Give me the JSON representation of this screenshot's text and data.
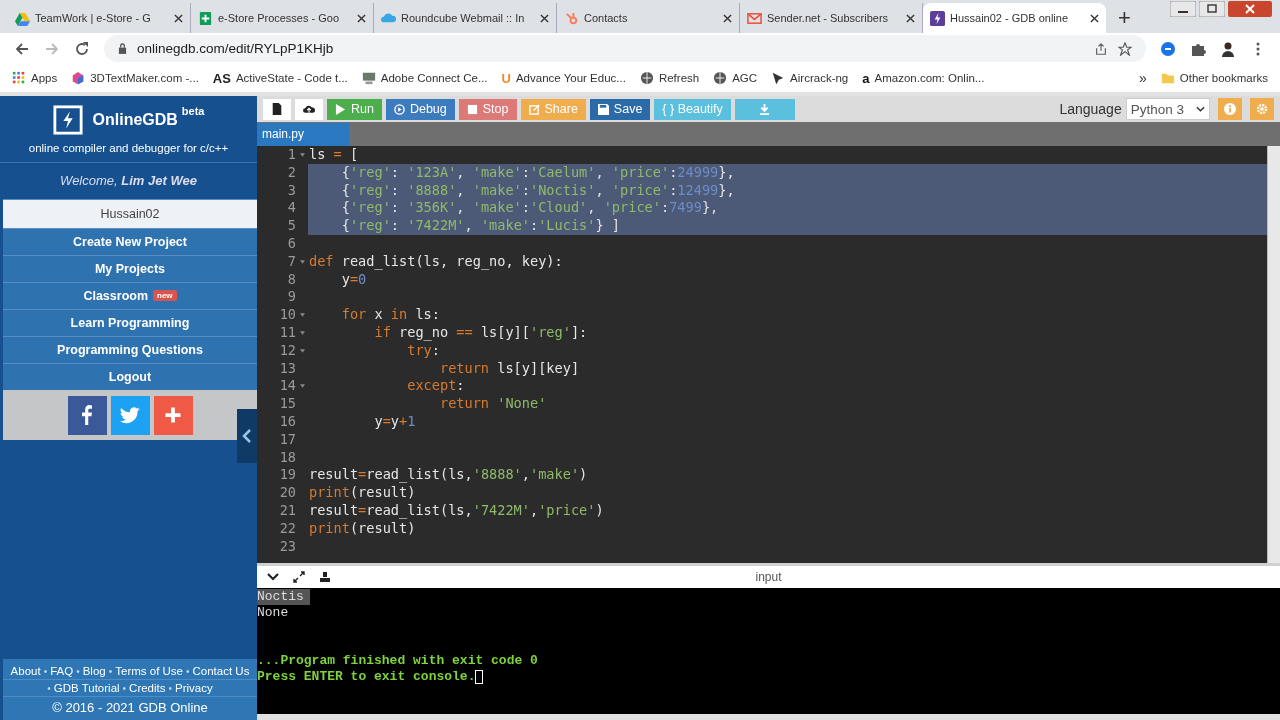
{
  "browser": {
    "tabs": [
      {
        "title": "TeamWork | e-Store - G",
        "selected": false
      },
      {
        "title": "e-Store Processes - Goo",
        "selected": false
      },
      {
        "title": "Roundcube Webmail :: In",
        "selected": false
      },
      {
        "title": "Contacts",
        "selected": false
      },
      {
        "title": "Sender.net - Subscribers",
        "selected": false
      },
      {
        "title": "Hussain02 - GDB online",
        "selected": true
      }
    ],
    "new_tab": "+",
    "url": "onlinegdb.com/edit/RYLpP1KHjb",
    "bookmarks": [
      {
        "label": "Apps"
      },
      {
        "label": "3DTextMaker.com -..."
      },
      {
        "label": "ActiveState - Code t...",
        "logo": "AS"
      },
      {
        "label": "Adobe Connect Ce..."
      },
      {
        "label": "Advance Your Educ...",
        "logo": "U"
      },
      {
        "label": "Refresh"
      },
      {
        "label": "AGC"
      },
      {
        "label": "Aircrack-ng"
      },
      {
        "label": "Amazon.com: Onlin...",
        "logo": "a"
      }
    ],
    "more": "»",
    "other_bookmarks": "Other bookmarks"
  },
  "sidebar": {
    "brand": "OnlineGDB",
    "brand_sup": "beta",
    "tagline": "online compiler and debugger for c/c++",
    "welcome": "Welcome, ",
    "user": "Lim Jet Wee",
    "items": [
      {
        "label": "Hussain02",
        "selected": true
      },
      {
        "label": "Create New Project",
        "selected": false
      },
      {
        "label": "My Projects",
        "selected": false
      },
      {
        "label": "Classroom",
        "selected": false,
        "badge": "new"
      },
      {
        "label": "Learn Programming",
        "selected": false
      },
      {
        "label": "Programming Questions",
        "selected": false
      },
      {
        "label": "Logout",
        "selected": false
      }
    ],
    "footer": [
      [
        {
          "kind": "link",
          "text": "About"
        },
        {
          "kind": "sep",
          "text": "•"
        },
        {
          "kind": "link",
          "text": "FAQ"
        },
        {
          "kind": "sep",
          "text": "•"
        },
        {
          "kind": "link",
          "text": "Blog"
        },
        {
          "kind": "sep",
          "text": "•"
        },
        {
          "kind": "link",
          "text": "Terms of Use"
        },
        {
          "kind": "sep",
          "text": "•"
        },
        {
          "kind": "link",
          "text": "Contact Us"
        }
      ],
      [
        {
          "kind": "sep",
          "text": "•"
        },
        {
          "kind": "link",
          "text": "GDB Tutorial"
        },
        {
          "kind": "sep",
          "text": "•"
        },
        {
          "kind": "link",
          "text": "Credits"
        },
        {
          "kind": "sep",
          "text": "•"
        },
        {
          "kind": "link",
          "text": "Privacy"
        }
      ]
    ],
    "copyright": "© 2016 - 2021 GDB Online"
  },
  "toolbar": {
    "buttons": [
      {
        "kind": "new"
      },
      {
        "kind": "upload"
      },
      {
        "kind": "run",
        "label": "Run"
      },
      {
        "kind": "debug",
        "label": "Debug"
      },
      {
        "kind": "stop",
        "label": "Stop"
      },
      {
        "kind": "share",
        "label": "Share"
      },
      {
        "kind": "save",
        "label": "Save"
      },
      {
        "kind": "beautify",
        "label": "{ } Beautify"
      },
      {
        "kind": "download"
      }
    ],
    "language_label": "Language",
    "language": "Python 3"
  },
  "file_tabs": [
    {
      "label": "main.py",
      "selected": true
    }
  ],
  "editor": {
    "lines": [
      {
        "n": "1",
        "fold": true,
        "selected": false,
        "tokens": [
          {
            "kind": "text",
            "text": "ls "
          },
          {
            "kind": "op",
            "text": "="
          },
          {
            "kind": "text",
            "text": " ["
          }
        ]
      },
      {
        "n": "2",
        "fold": false,
        "selected": true,
        "tokens": [
          {
            "kind": "text",
            "text": "    {"
          },
          {
            "kind": "str",
            "text": "'reg'"
          },
          {
            "kind": "text",
            "text": ": "
          },
          {
            "kind": "str",
            "text": "'123A'"
          },
          {
            "kind": "text",
            "text": ", "
          },
          {
            "kind": "str",
            "text": "'make'"
          },
          {
            "kind": "text",
            "text": ":"
          },
          {
            "kind": "str",
            "text": "'Caelum'"
          },
          {
            "kind": "text",
            "text": ", "
          },
          {
            "kind": "str",
            "text": "'price'"
          },
          {
            "kind": "text",
            "text": ":"
          },
          {
            "kind": "num",
            "text": "24999"
          },
          {
            "kind": "text",
            "text": "},"
          }
        ]
      },
      {
        "n": "3",
        "fold": false,
        "selected": true,
        "tokens": [
          {
            "kind": "text",
            "text": "    {"
          },
          {
            "kind": "str",
            "text": "'reg'"
          },
          {
            "kind": "text",
            "text": ": "
          },
          {
            "kind": "str",
            "text": "'8888'"
          },
          {
            "kind": "text",
            "text": ", "
          },
          {
            "kind": "str",
            "text": "'make'"
          },
          {
            "kind": "text",
            "text": ":"
          },
          {
            "kind": "str",
            "text": "'Noctis'"
          },
          {
            "kind": "text",
            "text": ", "
          },
          {
            "kind": "str",
            "text": "'price'"
          },
          {
            "kind": "text",
            "text": ":"
          },
          {
            "kind": "num",
            "text": "12499"
          },
          {
            "kind": "text",
            "text": "},"
          }
        ]
      },
      {
        "n": "4",
        "fold": false,
        "selected": true,
        "tokens": [
          {
            "kind": "text",
            "text": "    {"
          },
          {
            "kind": "str",
            "text": "'reg'"
          },
          {
            "kind": "text",
            "text": ": "
          },
          {
            "kind": "str",
            "text": "'356K'"
          },
          {
            "kind": "text",
            "text": ", "
          },
          {
            "kind": "str",
            "text": "'make'"
          },
          {
            "kind": "text",
            "text": ":"
          },
          {
            "kind": "str",
            "text": "'Cloud'"
          },
          {
            "kind": "text",
            "text": ", "
          },
          {
            "kind": "str",
            "text": "'price'"
          },
          {
            "kind": "text",
            "text": ":"
          },
          {
            "kind": "num",
            "text": "7499"
          },
          {
            "kind": "text",
            "text": "},"
          }
        ]
      },
      {
        "n": "5",
        "fold": false,
        "selected": true,
        "tokens": [
          {
            "kind": "text",
            "text": "    {"
          },
          {
            "kind": "str",
            "text": "'reg'"
          },
          {
            "kind": "text",
            "text": ": "
          },
          {
            "kind": "str",
            "text": "'7422M'"
          },
          {
            "kind": "text",
            "text": ", "
          },
          {
            "kind": "str",
            "text": "'make'"
          },
          {
            "kind": "text",
            "text": ":"
          },
          {
            "kind": "str",
            "text": "'Lucis'"
          },
          {
            "kind": "text",
            "text": "} ]"
          }
        ]
      },
      {
        "n": "6",
        "fold": false,
        "selected": false
      },
      {
        "n": "7",
        "fold": true,
        "selected": false,
        "tokens": [
          {
            "kind": "kw",
            "text": "def"
          },
          {
            "kind": "text",
            "text": " read_list(ls, reg_no, key):"
          }
        ]
      },
      {
        "n": "8",
        "fold": false,
        "selected": false,
        "tokens": [
          {
            "kind": "text",
            "text": "    y"
          },
          {
            "kind": "op",
            "text": "="
          },
          {
            "kind": "num",
            "text": "0"
          }
        ]
      },
      {
        "n": "9",
        "fold": false,
        "selected": false
      },
      {
        "n": "10",
        "fold": true,
        "selected": false,
        "tokens": [
          {
            "kind": "kw",
            "text": "    for"
          },
          {
            "kind": "text",
            "text": " x "
          },
          {
            "kind": "kw",
            "text": "in"
          },
          {
            "kind": "text",
            "text": " ls:"
          }
        ]
      },
      {
        "n": "11",
        "fold": true,
        "selected": false,
        "tokens": [
          {
            "kind": "kw",
            "text": "        if"
          },
          {
            "kind": "text",
            "text": " reg_no "
          },
          {
            "kind": "op",
            "text": "=="
          },
          {
            "kind": "text",
            "text": " ls[y]["
          },
          {
            "kind": "str",
            "text": "'reg'"
          },
          {
            "kind": "text",
            "text": "]:"
          }
        ]
      },
      {
        "n": "12",
        "fold": true,
        "selected": false,
        "tokens": [
          {
            "kind": "kw",
            "text": "            try"
          },
          {
            "kind": "text",
            "text": ":"
          }
        ]
      },
      {
        "n": "13",
        "fold": false,
        "selected": false,
        "tokens": [
          {
            "kind": "kw",
            "text": "                return"
          },
          {
            "kind": "text",
            "text": " ls[y][key]"
          }
        ]
      },
      {
        "n": "14",
        "fold": true,
        "selected": false,
        "tokens": [
          {
            "kind": "kw",
            "text": "            except"
          },
          {
            "kind": "text",
            "text": ":"
          }
        ]
      },
      {
        "n": "15",
        "fold": false,
        "selected": false,
        "tokens": [
          {
            "kind": "kw",
            "text": "                return"
          },
          {
            "kind": "str",
            "text": " 'None'"
          }
        ]
      },
      {
        "n": "16",
        "fold": false,
        "selected": false,
        "tokens": [
          {
            "kind": "text",
            "text": "        y"
          },
          {
            "kind": "op",
            "text": "="
          },
          {
            "kind": "text",
            "text": "y"
          },
          {
            "kind": "op",
            "text": "+"
          },
          {
            "kind": "num",
            "text": "1"
          }
        ]
      },
      {
        "n": "17",
        "fold": false,
        "selected": false
      },
      {
        "n": "18",
        "fold": false,
        "selected": false
      },
      {
        "n": "19",
        "fold": false,
        "selected": false,
        "tokens": [
          {
            "kind": "text",
            "text": "result"
          },
          {
            "kind": "op",
            "text": "="
          },
          {
            "kind": "text",
            "text": "read_list(ls,"
          },
          {
            "kind": "str",
            "text": "'8888'"
          },
          {
            "kind": "text",
            "text": ","
          },
          {
            "kind": "str",
            "text": "'make'"
          },
          {
            "kind": "text",
            "text": ")"
          }
        ]
      },
      {
        "n": "20",
        "fold": false,
        "selected": false,
        "tokens": [
          {
            "kind": "kw",
            "text": "print"
          },
          {
            "kind": "text",
            "text": "(result)"
          }
        ]
      },
      {
        "n": "21",
        "fold": false,
        "selected": false,
        "tokens": [
          {
            "kind": "text",
            "text": "result"
          },
          {
            "kind": "op",
            "text": "="
          },
          {
            "kind": "text",
            "text": "read_list(ls,"
          },
          {
            "kind": "str",
            "text": "'7422M'"
          },
          {
            "kind": "text",
            "text": ","
          },
          {
            "kind": "str",
            "text": "'price'"
          },
          {
            "kind": "text",
            "text": ")"
          }
        ]
      },
      {
        "n": "22",
        "fold": false,
        "selected": false,
        "tokens": [
          {
            "kind": "kw",
            "text": "print"
          },
          {
            "kind": "text",
            "text": "(result)"
          }
        ]
      },
      {
        "n": "23",
        "fold": false,
        "selected": false
      }
    ]
  },
  "console": {
    "label": "input",
    "lines": [
      {
        "kind": "out",
        "text": "Noctis",
        "selected": true
      },
      {
        "kind": "out",
        "text": "None",
        "selected": false
      },
      {
        "kind": "status",
        "text": "...Program finished with exit code 0",
        "selected": false
      },
      {
        "kind": "prompt",
        "text": "Press ENTER to exit console.",
        "selected": false
      }
    ]
  }
}
